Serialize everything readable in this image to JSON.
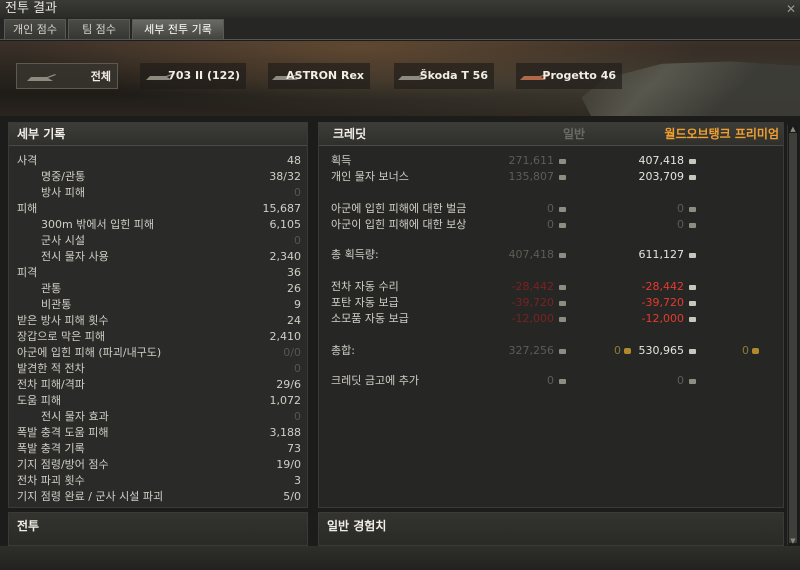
{
  "window": {
    "title": "전투 결과"
  },
  "tabs": [
    "개인 점수",
    "팀 점수",
    "세부 전투 기록"
  ],
  "vehicles": [
    {
      "label": "전체"
    },
    {
      "label": "703 II (122)"
    },
    {
      "label": "ASTRON Rex"
    },
    {
      "label": "Škoda T 56"
    },
    {
      "label": "Progetto 46"
    }
  ],
  "details": {
    "title": "세부 기록",
    "rows": [
      {
        "label": "사격",
        "value": "48"
      },
      {
        "label": "명중/관통",
        "value": "38/32"
      },
      {
        "label": "방사 피해",
        "value": "0"
      },
      {
        "label": "피해",
        "value": "15,687"
      },
      {
        "label": "300m 밖에서 입힌 피해",
        "value": "6,105"
      },
      {
        "label": "군사 시설",
        "value": "0"
      },
      {
        "label": "전시 물자 사용",
        "value": "2,340"
      },
      {
        "label": "피격",
        "value": "36"
      },
      {
        "label": "관통",
        "value": "26"
      },
      {
        "label": "비관통",
        "value": "9"
      },
      {
        "label": "받은 방사 피해 횟수",
        "value": "24"
      },
      {
        "label": "장갑으로 막은 피해",
        "value": "2,410"
      },
      {
        "label": "아군에 입힌 피해 (파괴/내구도)",
        "value": "0/0"
      },
      {
        "label": "발견한 적 전차",
        "value": "0"
      },
      {
        "label": "전차 피해/격파",
        "value": "29/6"
      },
      {
        "label": "도움 피해",
        "value": "1,072"
      },
      {
        "label": "전시 물자 효과",
        "value": "0"
      },
      {
        "label": "폭발 충격 도움 피해",
        "value": "3,188"
      },
      {
        "label": "폭발 충격 기록",
        "value": "73"
      },
      {
        "label": "기지 점령/방어 점수",
        "value": "19/0"
      },
      {
        "label": "전차 파괴 횟수",
        "value": "3"
      },
      {
        "label": "기지 점령 완료 / 군사 시설 파괴",
        "value": "5/0"
      }
    ]
  },
  "credits": {
    "title": "크레딧",
    "col_normal": "일반",
    "col_premium": "월드오브탱크 프리미엄",
    "rows": [
      {
        "label": "획득",
        "normal": "271,611",
        "premium": "407,418"
      },
      {
        "label": "개인 물자 보너스",
        "normal": "135,807",
        "premium": "203,709"
      },
      {
        "label": "아군에 입힌 피해에 대한 벌금",
        "normal": "0",
        "premium": "0"
      },
      {
        "label": "아군이 입힌 피해에 대한 보상",
        "normal": "0",
        "premium": "0"
      },
      {
        "label": "총 획득량:",
        "normal": "407,418",
        "premium": "611,127"
      },
      {
        "label": "전차 자동 수리",
        "normal": "-28,442",
        "premium": "-28,442"
      },
      {
        "label": "포탄 자동 보급",
        "normal": "-39,720",
        "premium": "-39,720"
      },
      {
        "label": "소모품 자동 보급",
        "normal": "-12,000",
        "premium": "-12,000"
      },
      {
        "label": "총합:",
        "normal": "327,256",
        "premium": "530,965",
        "gold_normal": "0",
        "gold_premium": "0"
      },
      {
        "label": "크레딧 금고에 추가",
        "normal": "0",
        "premium": "0"
      }
    ]
  },
  "battle": {
    "title": "전투"
  },
  "experience": {
    "title": "일반 경험치"
  },
  "colors": {
    "premium_accent": "#f0a030",
    "negative": "#e53a2e"
  }
}
